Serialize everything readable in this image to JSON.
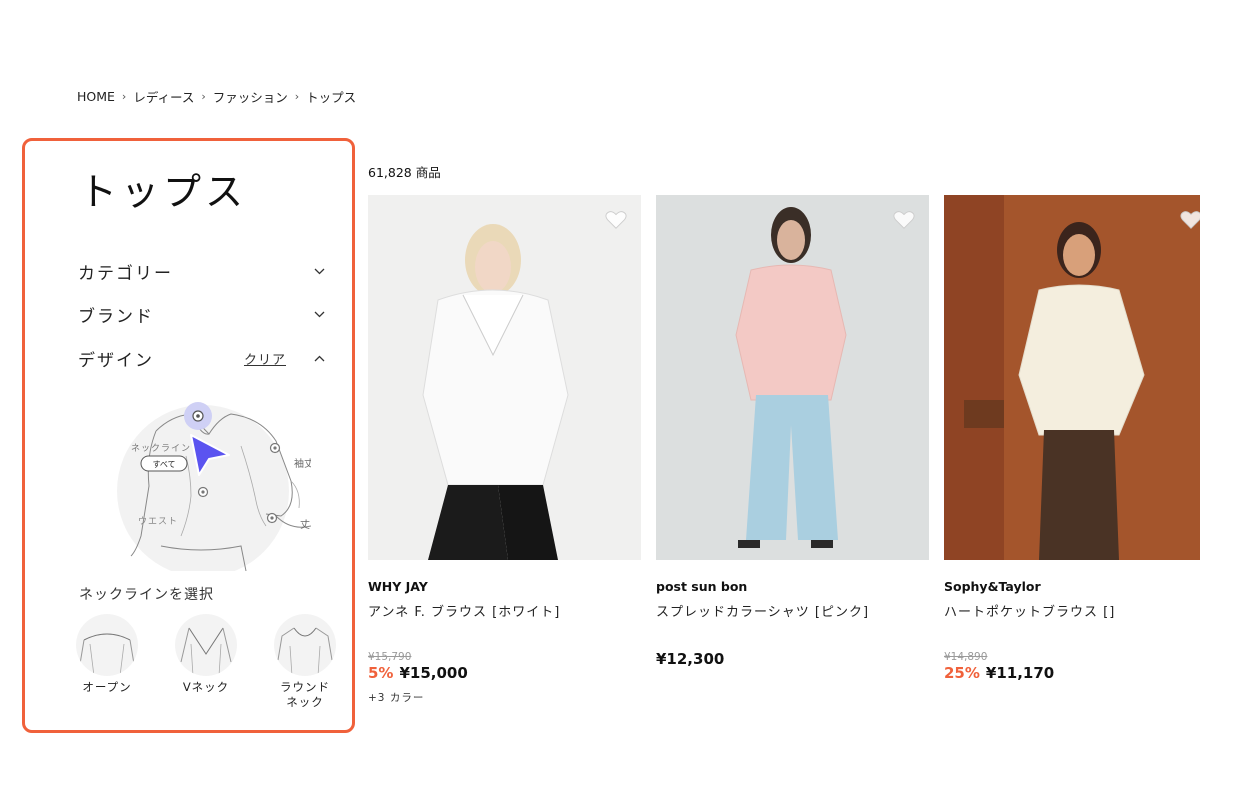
{
  "breadcrumb": {
    "items": [
      "HOME",
      "レディース",
      "ファッション",
      "トップス"
    ],
    "separator": "›"
  },
  "sidebar": {
    "title": "トップス",
    "filters": {
      "category": {
        "label": "カテゴリー",
        "expanded": false
      },
      "brand": {
        "label": "ブランド",
        "expanded": false
      },
      "design": {
        "label": "デザイン",
        "clear_label": "クリア",
        "expanded": true
      }
    },
    "design_map": {
      "neckline_label": "ネックライン",
      "all_badge": "すべて",
      "sleeve_label": "袖丈",
      "waist_label": "ウエスト",
      "length_label": "丈"
    },
    "neckline_heading": "ネックラインを選択",
    "neckline_options": [
      {
        "label": "オープン"
      },
      {
        "label": "Vネック"
      },
      {
        "label": "ラウンド\nネック"
      }
    ]
  },
  "results": {
    "count": "61,828 商品"
  },
  "products": [
    {
      "brand": "WHY JAY",
      "name": "アンネ F. ブラウス [ホワイト]",
      "original_price": "¥15,790",
      "discount": "5%",
      "price": "¥15,000",
      "colors": "+3 カラー"
    },
    {
      "brand": "post sun bon",
      "name": "スプレッドカラーシャツ [ピンク]",
      "price": "¥12,300"
    },
    {
      "brand": "Sophy&Taylor",
      "name": "ハートポケットブラウス []",
      "original_price": "¥14,890",
      "discount": "25%",
      "price": "¥11,170"
    }
  ],
  "colors": {
    "accent": "#f0613b",
    "cursor": "#5b54f0",
    "strike": "#9a9a9a"
  },
  "icons": {
    "heart": "heart-icon",
    "chevron_down": "chevron-down-icon",
    "chevron_up": "chevron-up-icon",
    "cursor": "pointer-cursor-icon"
  }
}
